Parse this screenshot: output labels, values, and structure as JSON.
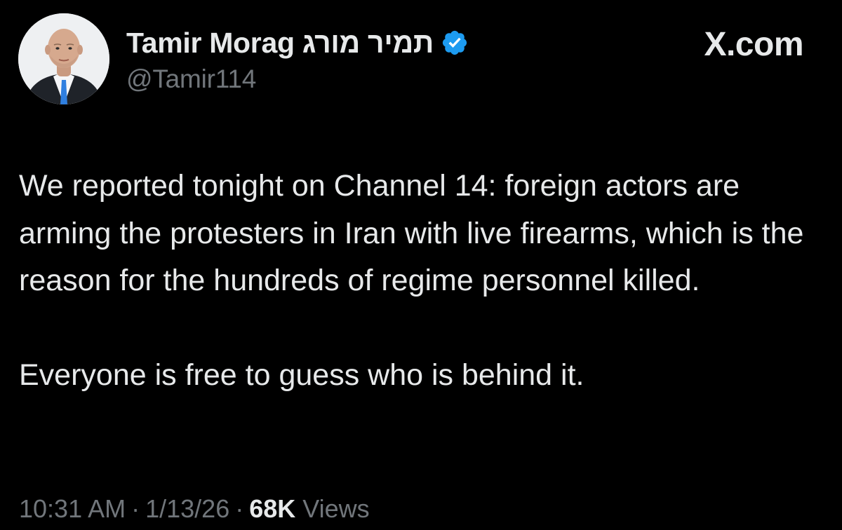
{
  "brand": {
    "label": "X.com"
  },
  "author": {
    "display_name": "Tamir Morag תמיר מורג",
    "handle": "@Tamir114",
    "verified_icon": "verified-badge-icon"
  },
  "tweet": {
    "paragraphs": [
      "We reported tonight on Channel 14: foreign actors are arming the protesters in Iran with live firearms, which is the reason for the hundreds of regime personnel killed.",
      "Everyone is free to guess who is behind it."
    ]
  },
  "meta": {
    "time": "10:31 AM",
    "date": "1/13/26",
    "views_count": "68K",
    "views_label": "Views"
  },
  "colors": {
    "background": "#000000",
    "text": "#e7e9ea",
    "secondary_text": "#71767b",
    "verified_blue": "#1d9bf0"
  }
}
